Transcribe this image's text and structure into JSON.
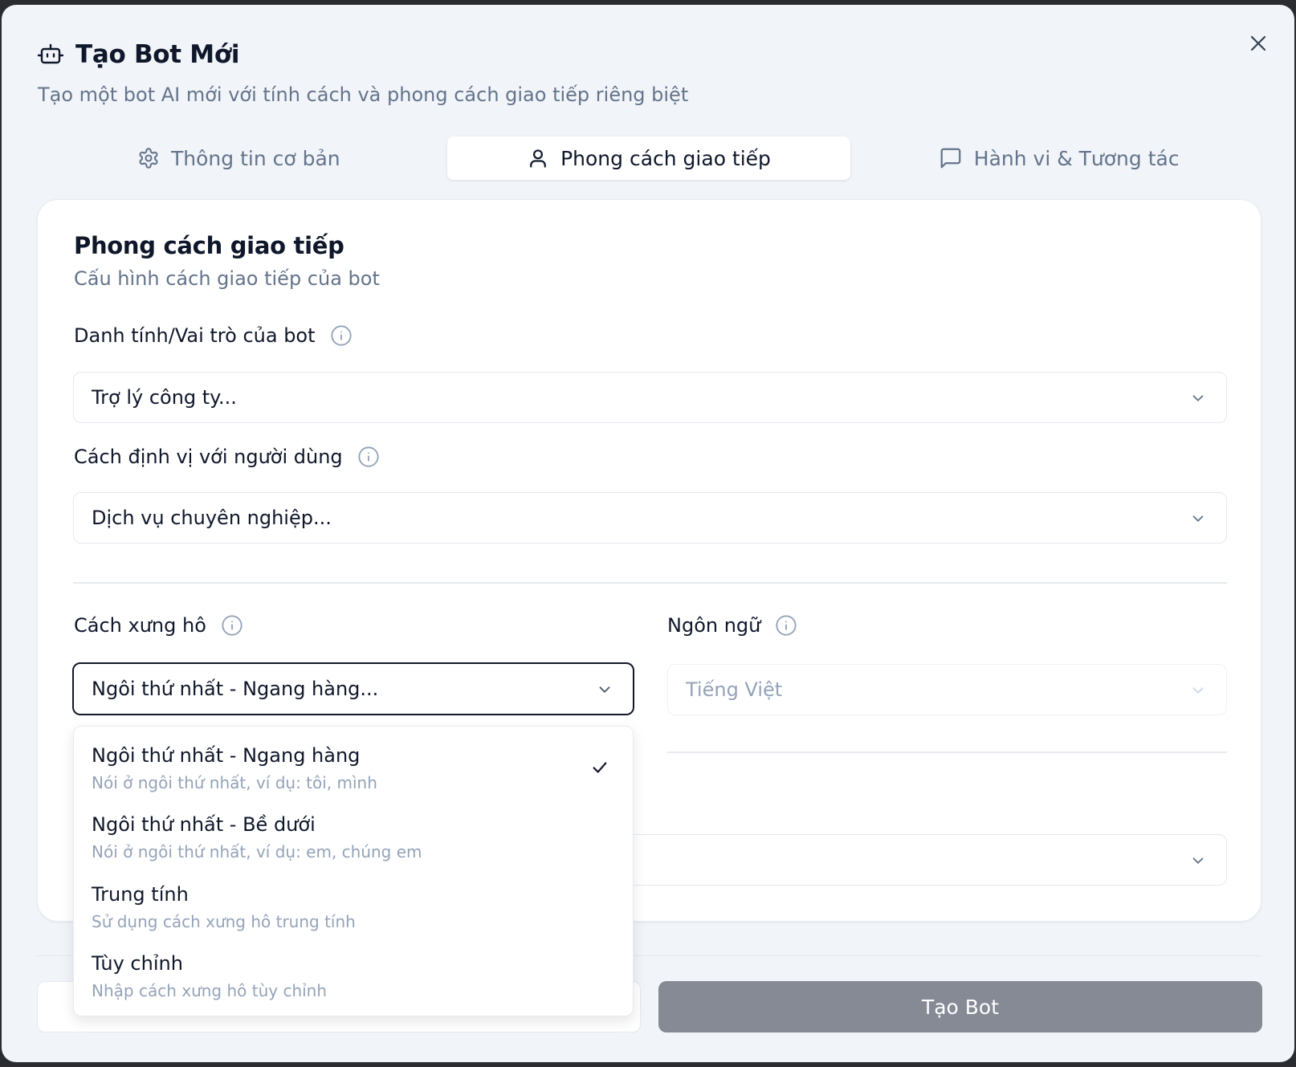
{
  "dialog": {
    "title": "Tạo Bot Mới",
    "subtitle": "Tạo một bot AI mới với tính cách và phong cách giao tiếp riêng biệt"
  },
  "tabs": [
    {
      "label": "Thông tin cơ bản",
      "icon": "gear-icon"
    },
    {
      "label": "Phong cách giao tiếp",
      "icon": "user-icon",
      "active": true
    },
    {
      "label": "Hành vi & Tương tác",
      "icon": "chat-icon"
    }
  ],
  "section": {
    "title": "Phong cách giao tiếp",
    "subtitle": "Cấu hình cách giao tiếp của bot"
  },
  "fields": {
    "identity": {
      "label": "Danh tính/Vai trò của bot",
      "value": "Trợ lý công ty..."
    },
    "positioning": {
      "label": "Cách định vị với người dùng",
      "value": "Dịch vụ chuyên nghiệp..."
    },
    "pronoun": {
      "label": "Cách xưng hô",
      "value": "Ngôi thứ nhất - Ngang hàng..."
    },
    "language": {
      "label": "Ngôn ngữ",
      "value": "Tiếng Việt"
    }
  },
  "pronoun_options": [
    {
      "label": "Ngôi thứ nhất - Ngang hàng",
      "desc": "Nói ở ngôi thứ nhất, ví dụ: tôi, mình",
      "selected": true
    },
    {
      "label": "Ngôi thứ nhất - Bề dưới",
      "desc": "Nói ở ngôi thứ nhất, ví dụ: em, chúng em"
    },
    {
      "label": "Trung tính",
      "desc": "Sử dụng cách xưng hô trung tính"
    },
    {
      "label": "Tùy chỉnh",
      "desc": "Nhập cách xưng hô tùy chỉnh"
    }
  ],
  "footer": {
    "primary_label": "Tạo Bot"
  },
  "colors": {
    "primary_button": "#868a95",
    "focus_border": "#111827",
    "muted_text": "#64748b"
  }
}
